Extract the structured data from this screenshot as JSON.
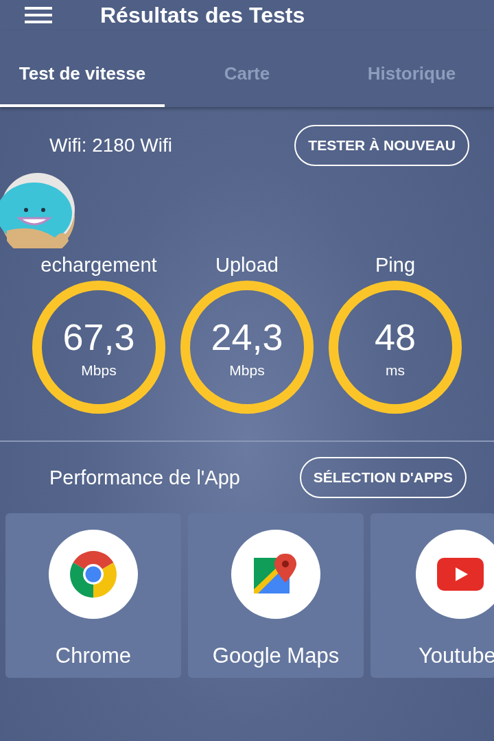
{
  "app_bar": {
    "title": "Résultats des Tests"
  },
  "tabs": [
    {
      "label": "Test de vitesse",
      "selected": true
    },
    {
      "label": "Carte",
      "selected": false
    },
    {
      "label": "Historique",
      "selected": false
    }
  ],
  "network": {
    "label": "Wifi: 2180 Wifi",
    "button": "TESTER À NOUVEAU"
  },
  "metrics": [
    {
      "label": "echargement",
      "value": "67,3",
      "unit": "Mbps"
    },
    {
      "label": "Upload",
      "value": "24,3",
      "unit": "Mbps"
    },
    {
      "label": "Ping",
      "value": "48",
      "unit": "ms"
    }
  ],
  "app_performance": {
    "title": "Performance de l'App",
    "button": "SÉLECTION D'APPS"
  },
  "apps": [
    {
      "kind": "chrome",
      "name": "Chrome"
    },
    {
      "kind": "maps",
      "name": "Google Maps"
    },
    {
      "kind": "youtube",
      "name": "Youtube"
    }
  ]
}
